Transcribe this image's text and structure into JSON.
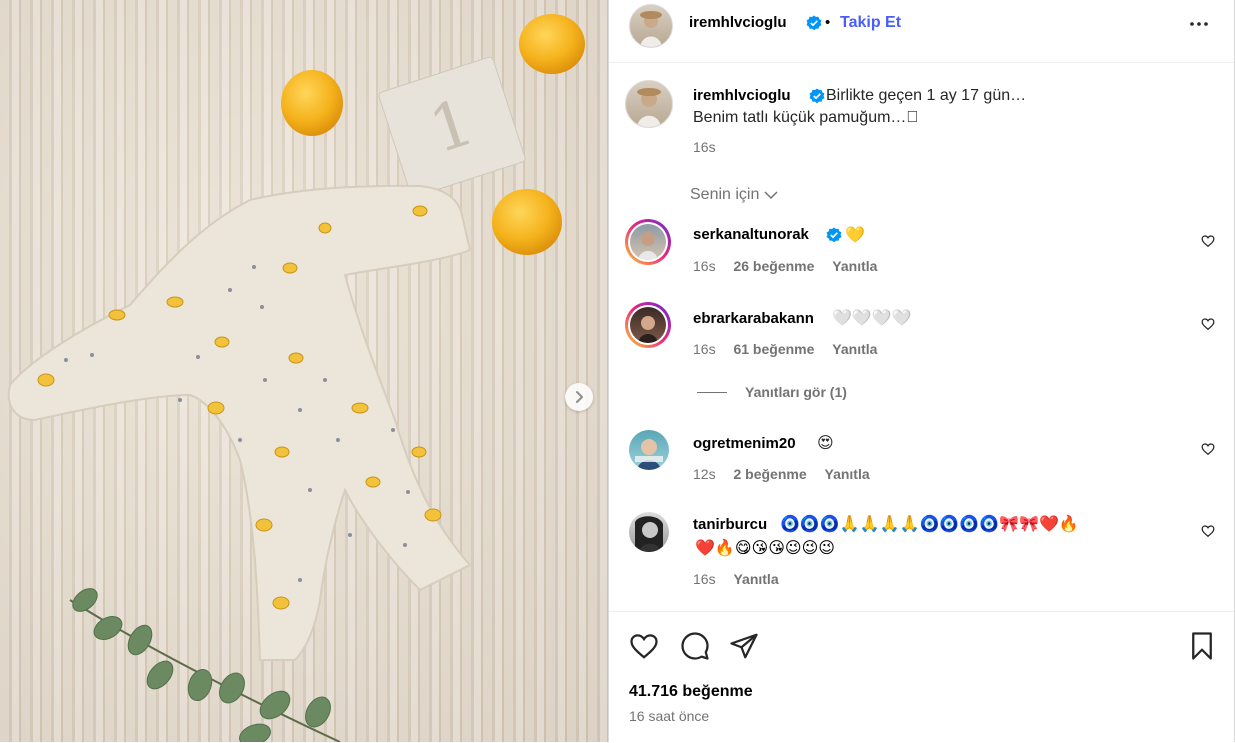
{
  "header": {
    "username": "iremhlvcioglu",
    "separator": "•",
    "follow_label": "Takip Et"
  },
  "caption": {
    "username": "iremhlvcioglu",
    "line1": "Birlikte geçen 1 ay 17 gün…",
    "line2": "Benim tatlı küçük pamuğum…􀀀",
    "time": "16s"
  },
  "filter_label": "Senin için",
  "comments": [
    {
      "username": "serkanaltunorak",
      "text": "💛",
      "time": "16s",
      "likes": "26 beğenme",
      "reply": "Yanıtla"
    },
    {
      "username": "ebrarkarabakann",
      "text": "🤍🤍🤍🤍",
      "time": "16s",
      "likes": "61 beğenme",
      "reply": "Yanıtla"
    },
    {
      "username": "ogretmenim20",
      "text": "😍",
      "time": "12s",
      "likes": "2 beğenme",
      "reply": "Yanıtla"
    },
    {
      "username": "tanirburcu",
      "line1": "🧿🧿🧿🙏🙏🙏🙏🧿🧿🧿🧿🎀🎀❤️🔥",
      "line2": "❤️🔥😋😘😘😉😉😉",
      "time": "16s",
      "reply": "Yanıtla"
    }
  ],
  "view_replies": "Yanıtları gör (1)",
  "footer": {
    "likes": "41.716 beğenme",
    "time": "16 saat önce"
  },
  "colors": {
    "accent": "#4a5df9",
    "verified": "#0095f6",
    "muted": "#737373",
    "lemon": "#f2b21a",
    "onesie": "#ece6da"
  },
  "photo": {
    "card_number": "1"
  }
}
